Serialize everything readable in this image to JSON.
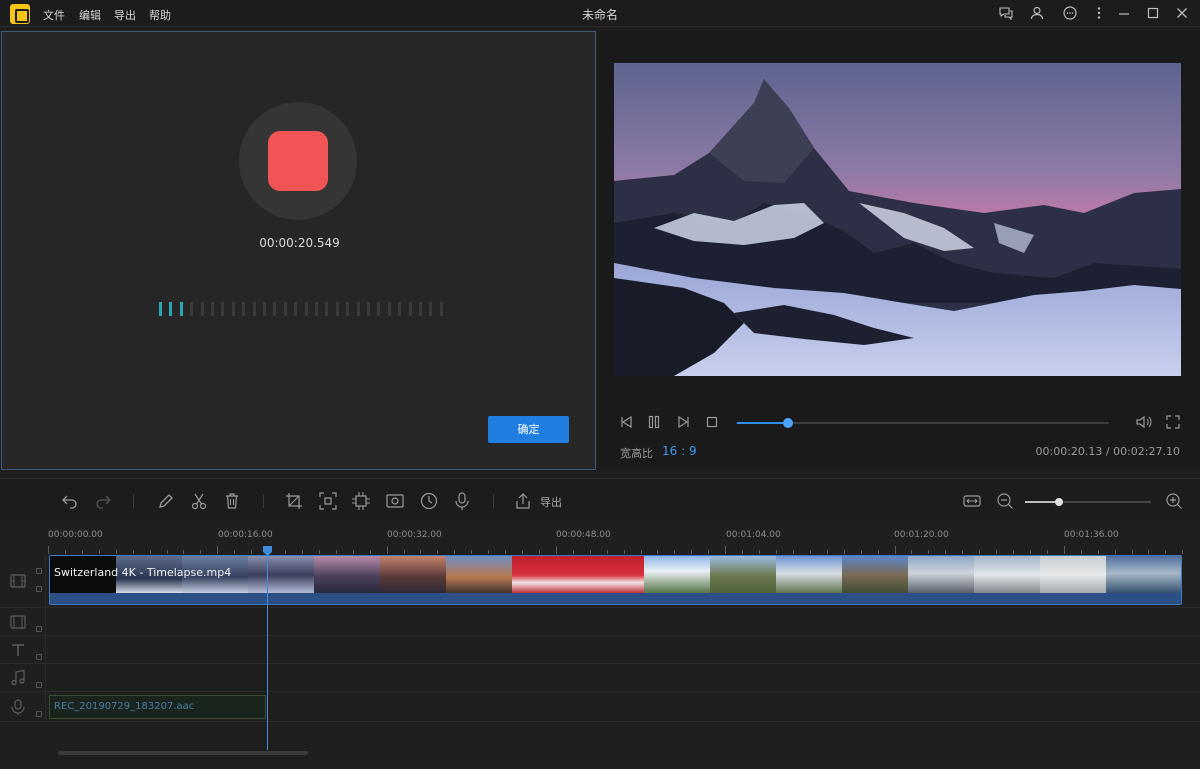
{
  "titlebar": {
    "title": "未命名",
    "menus": [
      "文件",
      "编辑",
      "导出",
      "帮助"
    ]
  },
  "record": {
    "elapsed": "00:00:20.549",
    "level_on_bars": 3,
    "level_total_bars": 28,
    "confirm_label": "确定"
  },
  "preview": {
    "aspect_label": "宽高比",
    "aspect_value": "16 : 9",
    "time_display": "00:00:20.13 / 00:02:27.10",
    "progress": 0.136
  },
  "toolbar": {
    "export_label": "导出",
    "zoom_level": 0.27
  },
  "timeline": {
    "ruler_labels": [
      "00:00:00.00",
      "00:00:16.00",
      "00:00:32.00",
      "00:00:48.00",
      "00:01:04.00",
      "00:01:20.00",
      "00:01:36.00"
    ],
    "video_clip_name": "Switzerland 4K - Timelapse.mp4",
    "audio_clip_name": "REC_20190729_183207.aac"
  },
  "colors": {
    "accent": "#1f7ee0",
    "record": "#f05454",
    "level_on": "#2aa7b3"
  }
}
